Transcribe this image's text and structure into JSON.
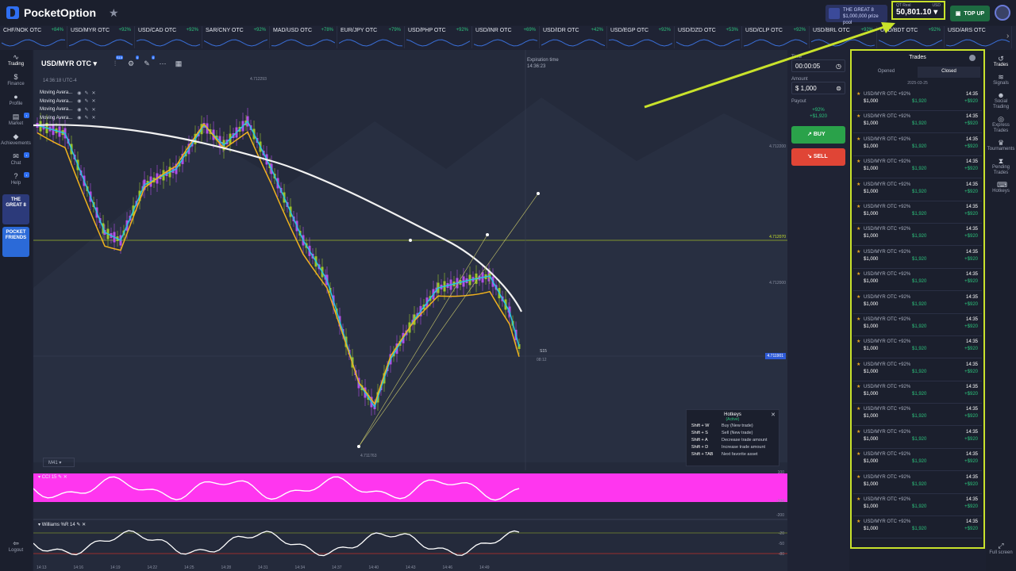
{
  "header": {
    "logo": "PocketOption",
    "promo_title": "THE GREAT 8",
    "promo_sub": "$1,000,000 prize pool",
    "balance_label": "QT Real",
    "balance_currency": "USD",
    "balance": "50,801.10",
    "topup": "TOP UP"
  },
  "ticker": [
    {
      "name": "CHF/NOK OTC",
      "pct": "+84%"
    },
    {
      "name": "USD/MYR OTC",
      "pct": "+92%"
    },
    {
      "name": "USD/CAD OTC",
      "pct": "+92%"
    },
    {
      "name": "SAR/CNY OTC",
      "pct": "+92%"
    },
    {
      "name": "MAD/USD OTC",
      "pct": "+78%"
    },
    {
      "name": "EUR/JPY OTC",
      "pct": "+79%"
    },
    {
      "name": "USD/PHP OTC",
      "pct": "+92%"
    },
    {
      "name": "USD/INR OTC",
      "pct": "+69%"
    },
    {
      "name": "USD/IDR OTC",
      "pct": "+42%"
    },
    {
      "name": "USD/EGP OTC",
      "pct": "+92%"
    },
    {
      "name": "USD/DZD OTC",
      "pct": "+53%"
    },
    {
      "name": "USD/CLP OTC",
      "pct": "+92%"
    },
    {
      "name": "USD/BRL OTC",
      "pct": "+92%"
    },
    {
      "name": "USD/BDT OTC",
      "pct": "+92%"
    },
    {
      "name": "USD/ARS OTC",
      "pct": ""
    }
  ],
  "left_nav": [
    {
      "label": "Trading",
      "icon": "chart-line-icon"
    },
    {
      "label": "Finance",
      "icon": "dollar-icon"
    },
    {
      "label": "Profile",
      "icon": "user-icon"
    },
    {
      "label": "Market",
      "icon": "cart-icon"
    },
    {
      "label": "Achievements",
      "icon": "diamond-icon"
    },
    {
      "label": "Chat",
      "icon": "chat-icon"
    },
    {
      "label": "Help",
      "icon": "help-icon"
    }
  ],
  "left_promos": {
    "great8": "THE GREAT 8",
    "friends": "POCKET FRIENDS"
  },
  "logout": "Logout",
  "chart": {
    "asset": "USD/MYR OTC",
    "time": "14:36:18 UTC-4",
    "indicators": [
      "Moving Avera...",
      "Moving Avera...",
      "Moving Avera...",
      "Moving Avera..."
    ],
    "expiration_label": "Expiration time",
    "expiration_time": "14:36:23",
    "price_high": "4.712293",
    "price_low": "4.711763",
    "price_a": "4.712200",
    "price_line": "4.712070",
    "price_b": "4.712000",
    "price_current": "4.711901",
    "countdown_label": "S15",
    "countdown_time": "08:12",
    "timeframe": "M41",
    "osc1_label": "CCI 15",
    "osc2_label": "Williams %R 14",
    "osc1_ticks": [
      "100",
      "-100",
      "-200"
    ],
    "osc2_ticks": [
      "-20",
      "-50",
      "-80"
    ],
    "x_ticks": [
      "14:13",
      "14:16",
      "14:19",
      "14:22",
      "14:25",
      "14:28",
      "14:31",
      "14:34",
      "14:37",
      "14:40",
      "14:43",
      "14:46",
      "14:49"
    ]
  },
  "hotkeys": {
    "title": "Hotkeys",
    "status": "(Active)",
    "rows": [
      {
        "key": "Shift + W",
        "desc": "Buy (New trade)"
      },
      {
        "key": "Shift + S",
        "desc": "Sell (New trade)"
      },
      {
        "key": "Shift + A",
        "desc": "Decrease trade amount"
      },
      {
        "key": "Shift + D",
        "desc": "Increase trade amount"
      },
      {
        "key": "Shift + TAB",
        "desc": "Next favorite asset"
      }
    ]
  },
  "controls": {
    "time_label": "Time",
    "time": "00:00:05",
    "amount_label": "Amount",
    "amount": "1,000",
    "payout_label": "Payout",
    "payout_pct": "+92%",
    "payout_amt": "+$1,920",
    "buy": "BUY",
    "sell": "SELL"
  },
  "trades": {
    "title": "Trades",
    "tab_opened": "Opened",
    "tab_closed": "Closed",
    "date": "2025-03-25",
    "rows": [
      {
        "asset": "USD/MYR OTC +92%",
        "amount": "$1,000",
        "payout": "$1,920",
        "time": "14:35",
        "profit": "+$920"
      },
      {
        "asset": "USD/MYR OTC +92%",
        "amount": "$1,000",
        "payout": "$1,920",
        "time": "14:35",
        "profit": "+$920"
      },
      {
        "asset": "USD/MYR OTC +92%",
        "amount": "$1,000",
        "payout": "$1,920",
        "time": "14:35",
        "profit": "+$920"
      },
      {
        "asset": "USD/MYR OTC +92%",
        "amount": "$1,000",
        "payout": "$1,920",
        "time": "14:35",
        "profit": "+$920"
      },
      {
        "asset": "USD/MYR OTC +92%",
        "amount": "$1,000",
        "payout": "$1,920",
        "time": "14:35",
        "profit": "+$920"
      },
      {
        "asset": "USD/MYR OTC +92%",
        "amount": "$1,000",
        "payout": "$1,920",
        "time": "14:35",
        "profit": "+$920"
      },
      {
        "asset": "USD/MYR OTC +92%",
        "amount": "$1,000",
        "payout": "$1,920",
        "time": "14:35",
        "profit": "+$920"
      },
      {
        "asset": "USD/MYR OTC +92%",
        "amount": "$1,000",
        "payout": "$1,920",
        "time": "14:35",
        "profit": "+$920"
      },
      {
        "asset": "USD/MYR OTC +92%",
        "amount": "$1,000",
        "payout": "$1,920",
        "time": "14:35",
        "profit": "+$920"
      },
      {
        "asset": "USD/MYR OTC +92%",
        "amount": "$1,000",
        "payout": "$1,920",
        "time": "14:35",
        "profit": "+$920"
      },
      {
        "asset": "USD/MYR OTC +92%",
        "amount": "$1,000",
        "payout": "$1,920",
        "time": "14:35",
        "profit": "+$920"
      },
      {
        "asset": "USD/MYR OTC +92%",
        "amount": "$1,000",
        "payout": "$1,920",
        "time": "14:35",
        "profit": "+$920"
      },
      {
        "asset": "USD/MYR OTC +92%",
        "amount": "$1,000",
        "payout": "$1,920",
        "time": "14:35",
        "profit": "+$920"
      },
      {
        "asset": "USD/MYR OTC +92%",
        "amount": "$1,000",
        "payout": "$1,920",
        "time": "14:35",
        "profit": "+$920"
      },
      {
        "asset": "USD/MYR OTC +92%",
        "amount": "$1,000",
        "payout": "$1,920",
        "time": "14:35",
        "profit": "+$920"
      },
      {
        "asset": "USD/MYR OTC +92%",
        "amount": "$1,000",
        "payout": "$1,920",
        "time": "14:35",
        "profit": "+$920"
      },
      {
        "asset": "USD/MYR OTC +92%",
        "amount": "$1,000",
        "payout": "$1,920",
        "time": "14:35",
        "profit": "+$920"
      },
      {
        "asset": "USD/MYR OTC +92%",
        "amount": "$1,000",
        "payout": "$1,920",
        "time": "14:35",
        "profit": "+$920"
      },
      {
        "asset": "USD/MYR OTC +92%",
        "amount": "$1,000",
        "payout": "$1,920",
        "time": "14:35",
        "profit": "+$920"
      },
      {
        "asset": "USD/MYR OTC +92%",
        "amount": "$1,000",
        "payout": "$1,920",
        "time": "14:35",
        "profit": "+$920"
      }
    ]
  },
  "right_rail": [
    {
      "label": "Trades",
      "icon": "history-icon"
    },
    {
      "label": "Signals",
      "icon": "signal-icon"
    },
    {
      "label": "Social Trading",
      "icon": "users-icon"
    },
    {
      "label": "Express Trades",
      "icon": "express-icon"
    },
    {
      "label": "Tournaments",
      "icon": "trophy-icon"
    },
    {
      "label": "Pending Trades",
      "icon": "hourglass-icon"
    },
    {
      "label": "Hotkeys",
      "icon": "keyboard-icon"
    }
  ],
  "fullscreen": "Full screen",
  "colors": {
    "accent": "#c9e22b",
    "buy": "#2aa24a",
    "sell": "#e04536",
    "brand": "#2f6ff2",
    "profit": "#2cc47c"
  }
}
